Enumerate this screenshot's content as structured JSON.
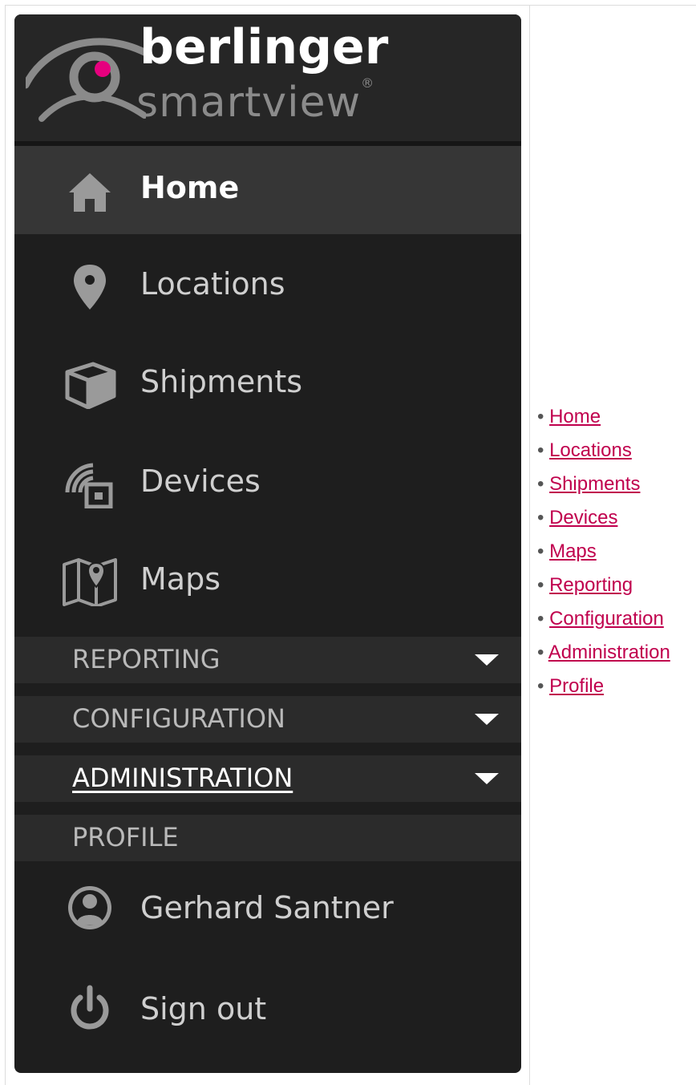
{
  "logo": {
    "brand": "berlinger",
    "product": "smartview",
    "trademark": "®",
    "accent_color": "#e6007e"
  },
  "sidebar": {
    "nav": [
      {
        "label": "Home",
        "icon": "home-icon",
        "active": true
      },
      {
        "label": "Locations",
        "icon": "location-pin-icon"
      },
      {
        "label": "Shipments",
        "icon": "package-icon"
      },
      {
        "label": "Devices",
        "icon": "device-signal-icon"
      },
      {
        "label": "Maps",
        "icon": "map-icon"
      }
    ],
    "sections": [
      {
        "label": "REPORTING",
        "expandable": true
      },
      {
        "label": "CONFIGURATION",
        "expandable": true
      },
      {
        "label": "ADMINISTRATION",
        "expandable": true,
        "focused": true
      },
      {
        "label": "PROFILE",
        "expandable": false
      }
    ],
    "profile": [
      {
        "label": "Gerhard Santner",
        "icon": "user-avatar-icon"
      },
      {
        "label": "Sign out",
        "icon": "power-icon"
      }
    ]
  },
  "links": {
    "bullet": "•",
    "items": [
      "Home",
      "Locations",
      "Shipments",
      "Devices",
      "Maps",
      "Reporting",
      "Configuration",
      "Administration",
      "Profile"
    ]
  },
  "colors": {
    "sidebar_bg": "#1e1e1e",
    "active_bg": "#363636",
    "section_bg": "#2b2b2b",
    "link": "#c0004d"
  }
}
